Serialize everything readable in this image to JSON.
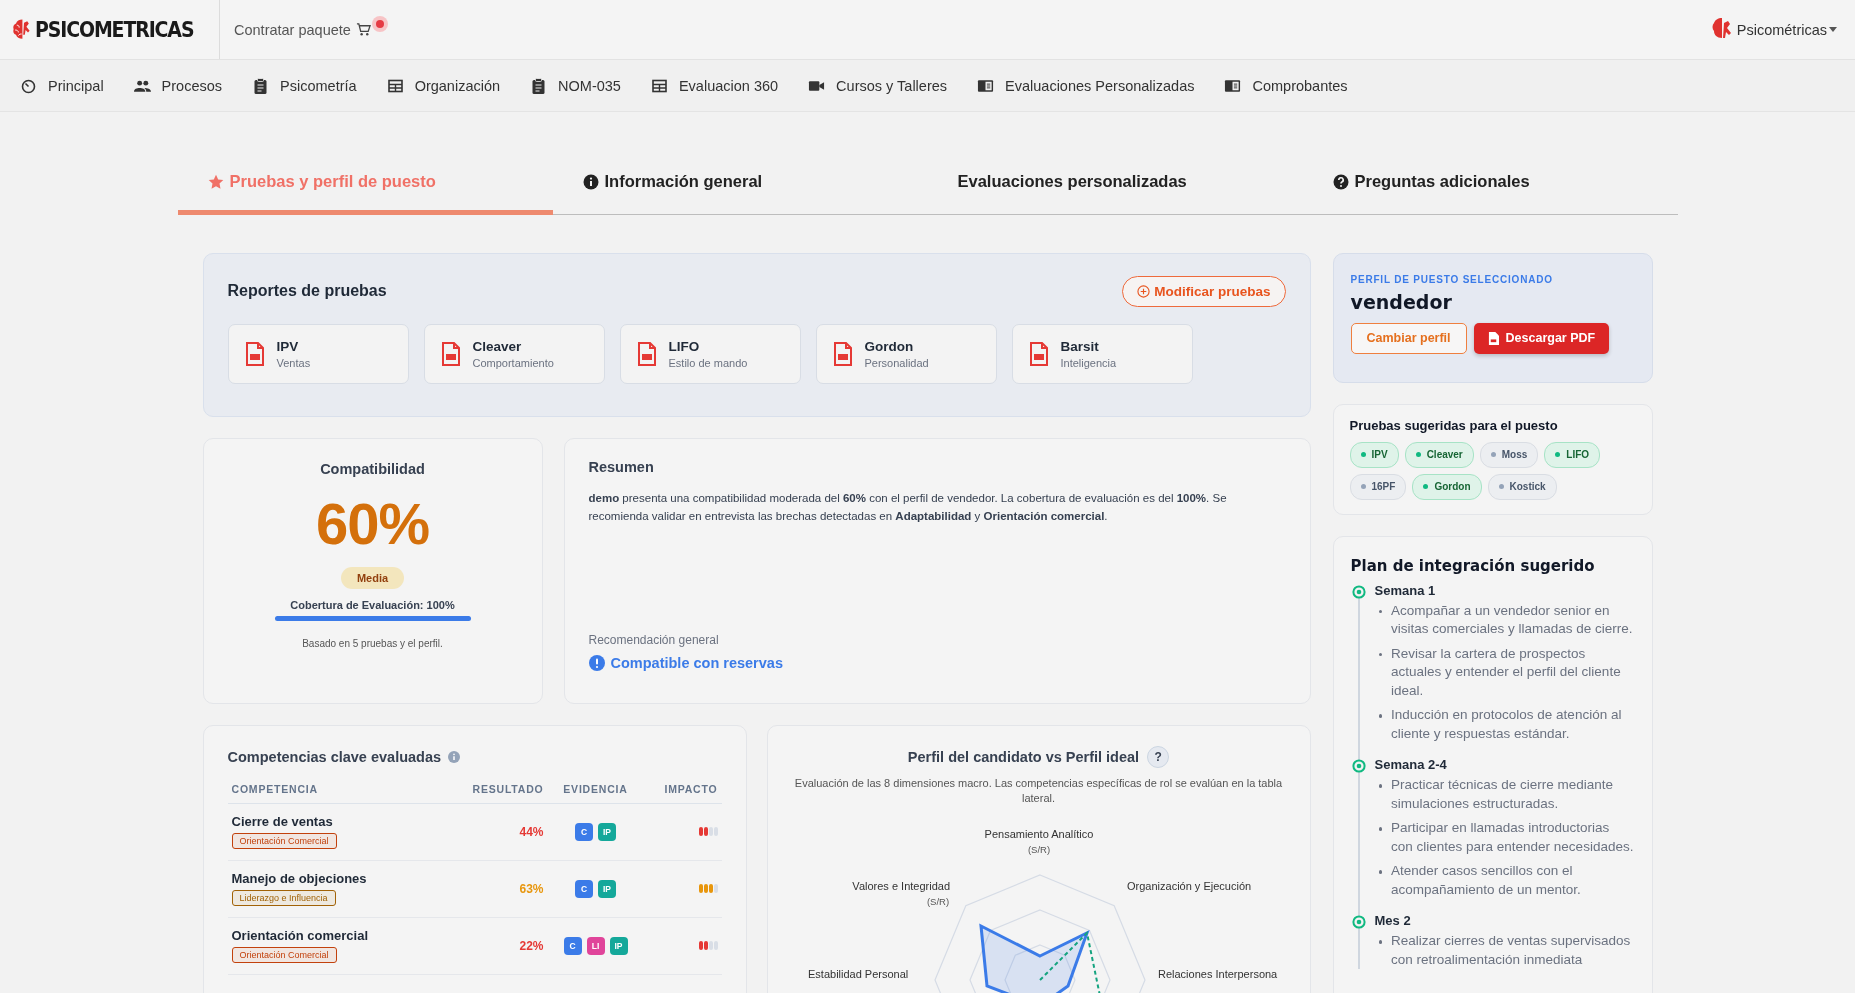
{
  "header": {
    "brand": "PSICOMETRICAS",
    "promo": "Contratar paquete",
    "user": "Psicométricas"
  },
  "nav": [
    {
      "label": "Principal"
    },
    {
      "label": "Procesos"
    },
    {
      "label": "Psicometría"
    },
    {
      "label": "Organización"
    },
    {
      "label": "NOM-035"
    },
    {
      "label": "Evaluacion 360"
    },
    {
      "label": "Cursos y Talleres"
    },
    {
      "label": "Evaluaciones Personalizadas"
    },
    {
      "label": "Comprobantes"
    }
  ],
  "tabs": [
    {
      "label": "Pruebas y perfil de puesto",
      "selected": true
    },
    {
      "label": "Información general",
      "selected": false
    },
    {
      "label": "Evaluaciones personalizadas",
      "selected": false
    },
    {
      "label": "Preguntas adicionales",
      "selected": false
    }
  ],
  "reports": {
    "title": "Reportes de pruebas",
    "action": "Modificar pruebas",
    "items": [
      {
        "name": "IPV",
        "desc": "Ventas"
      },
      {
        "name": "Cleaver",
        "desc": "Comportamiento"
      },
      {
        "name": "LIFO",
        "desc": "Estilo de mando"
      },
      {
        "name": "Gordon",
        "desc": "Personalidad"
      },
      {
        "name": "Barsit",
        "desc": "Inteligencia"
      }
    ]
  },
  "compatibility": {
    "title": "Compatibilidad",
    "value": "60%",
    "color": "#d4700b",
    "badge": "Media",
    "coverage_label": "Cobertura de Evaluación: 100%",
    "level": 1,
    "note": "Basado en 5 pruebas y el perfil."
  },
  "summary": {
    "title": "Resumen",
    "text": "**demo** presenta una compatibilidad moderada del **60%** con el perfil de vendedor. La cobertura de evaluación es del **100%**. Se recomienda validar en entrevista las brechas detectadas en **Adaptabilidad** y **Orientación comercial**.",
    "recommendation_label": "Recomendación general",
    "recommendation": "Compatible con reservas"
  },
  "competencies": {
    "title": "Competencias clave evaluadas",
    "columns": [
      "COMPETENCIA",
      "RESULTADO",
      "EVIDENCIA",
      "IMPACTO"
    ],
    "rows": [
      {
        "name": "Cierre de ventas",
        "tag": {
          "label": "Orientación Comercial",
          "color": "#c2410c"
        },
        "result": "44%",
        "color": "#e53935",
        "evidence": [
          {
            "code": "C",
            "color": "#3b7be8"
          },
          {
            "code": "IP",
            "color": "#14a89a"
          }
        ],
        "level": 0.5
      },
      {
        "name": "Manejo de objeciones",
        "tag": {
          "label": "Liderazgo e Influencia",
          "color": "#a16207"
        },
        "result": "63%",
        "color": "#e8960c",
        "evidence": [
          {
            "code": "C",
            "color": "#3b7be8"
          },
          {
            "code": "IP",
            "color": "#14a89a"
          }
        ],
        "level": 0.75
      },
      {
        "name": "Orientación comercial",
        "tag": {
          "label": "Orientación Comercial",
          "color": "#c2410c"
        },
        "result": "22%",
        "color": "#e53935",
        "evidence": [
          {
            "code": "C",
            "color": "#3b7be8"
          },
          {
            "code": "LI",
            "color": "#e0449a"
          },
          {
            "code": "IP",
            "color": "#14a89a"
          }
        ],
        "level": 0.5
      }
    ]
  },
  "chart": {
    "title": "Perfil del candidato vs Perfil ideal",
    "help": "?",
    "subtitle": "Evaluación de las 8 dimensiones macro. Las competencias específicas de rol se evalúan en la tabla lateral.",
    "axes": [
      {
        "label": "Pensamiento Analítico",
        "note": "(S/R)"
      },
      {
        "label": "Valores e Integridad",
        "note": "(S/R)"
      },
      {
        "label": "Organización y Ejecución"
      },
      {
        "label": "Estabilidad Personal"
      },
      {
        "label": "Relaciones Interpersona"
      }
    ]
  },
  "profile": {
    "label": "PERFIL DE PUESTO SELECCIONADO",
    "name": "vendedor",
    "change": "Cambiar perfil",
    "download": "Descargar PDF"
  },
  "suggested": {
    "title": "Pruebas sugeridas para el puesto",
    "chips": [
      {
        "label": "IPV",
        "matched": true
      },
      {
        "label": "Cleaver",
        "matched": true
      },
      {
        "label": "Moss",
        "matched": false
      },
      {
        "label": "LIFO",
        "matched": true
      },
      {
        "label": "16PF",
        "matched": false
      },
      {
        "label": "Gordon",
        "matched": true
      },
      {
        "label": "Kostick",
        "matched": false
      }
    ]
  },
  "plan": {
    "title": "Plan de integración sugerido",
    "steps": [
      {
        "title": "Semana 1",
        "items": [
          "Acompañar a un vendedor senior en visitas comerciales y llamadas de cierre.",
          "Revisar la cartera de prospectos actuales y entender el perfil del cliente ideal.",
          "Inducción en protocolos de atención al cliente y respuestas estándar."
        ]
      },
      {
        "title": "Semana 2-4",
        "items": [
          "Practicar técnicas de cierre mediante simulaciones estructuradas.",
          "Participar en llamadas introductorias con clientes para entender necesidades.",
          "Atender casos sencillos con el acompañamiento de un mentor."
        ]
      },
      {
        "title": "Mes 2",
        "items": [
          "Realizar cierres de ventas supervisados con retroalimentación inmediata"
        ]
      }
    ]
  }
}
